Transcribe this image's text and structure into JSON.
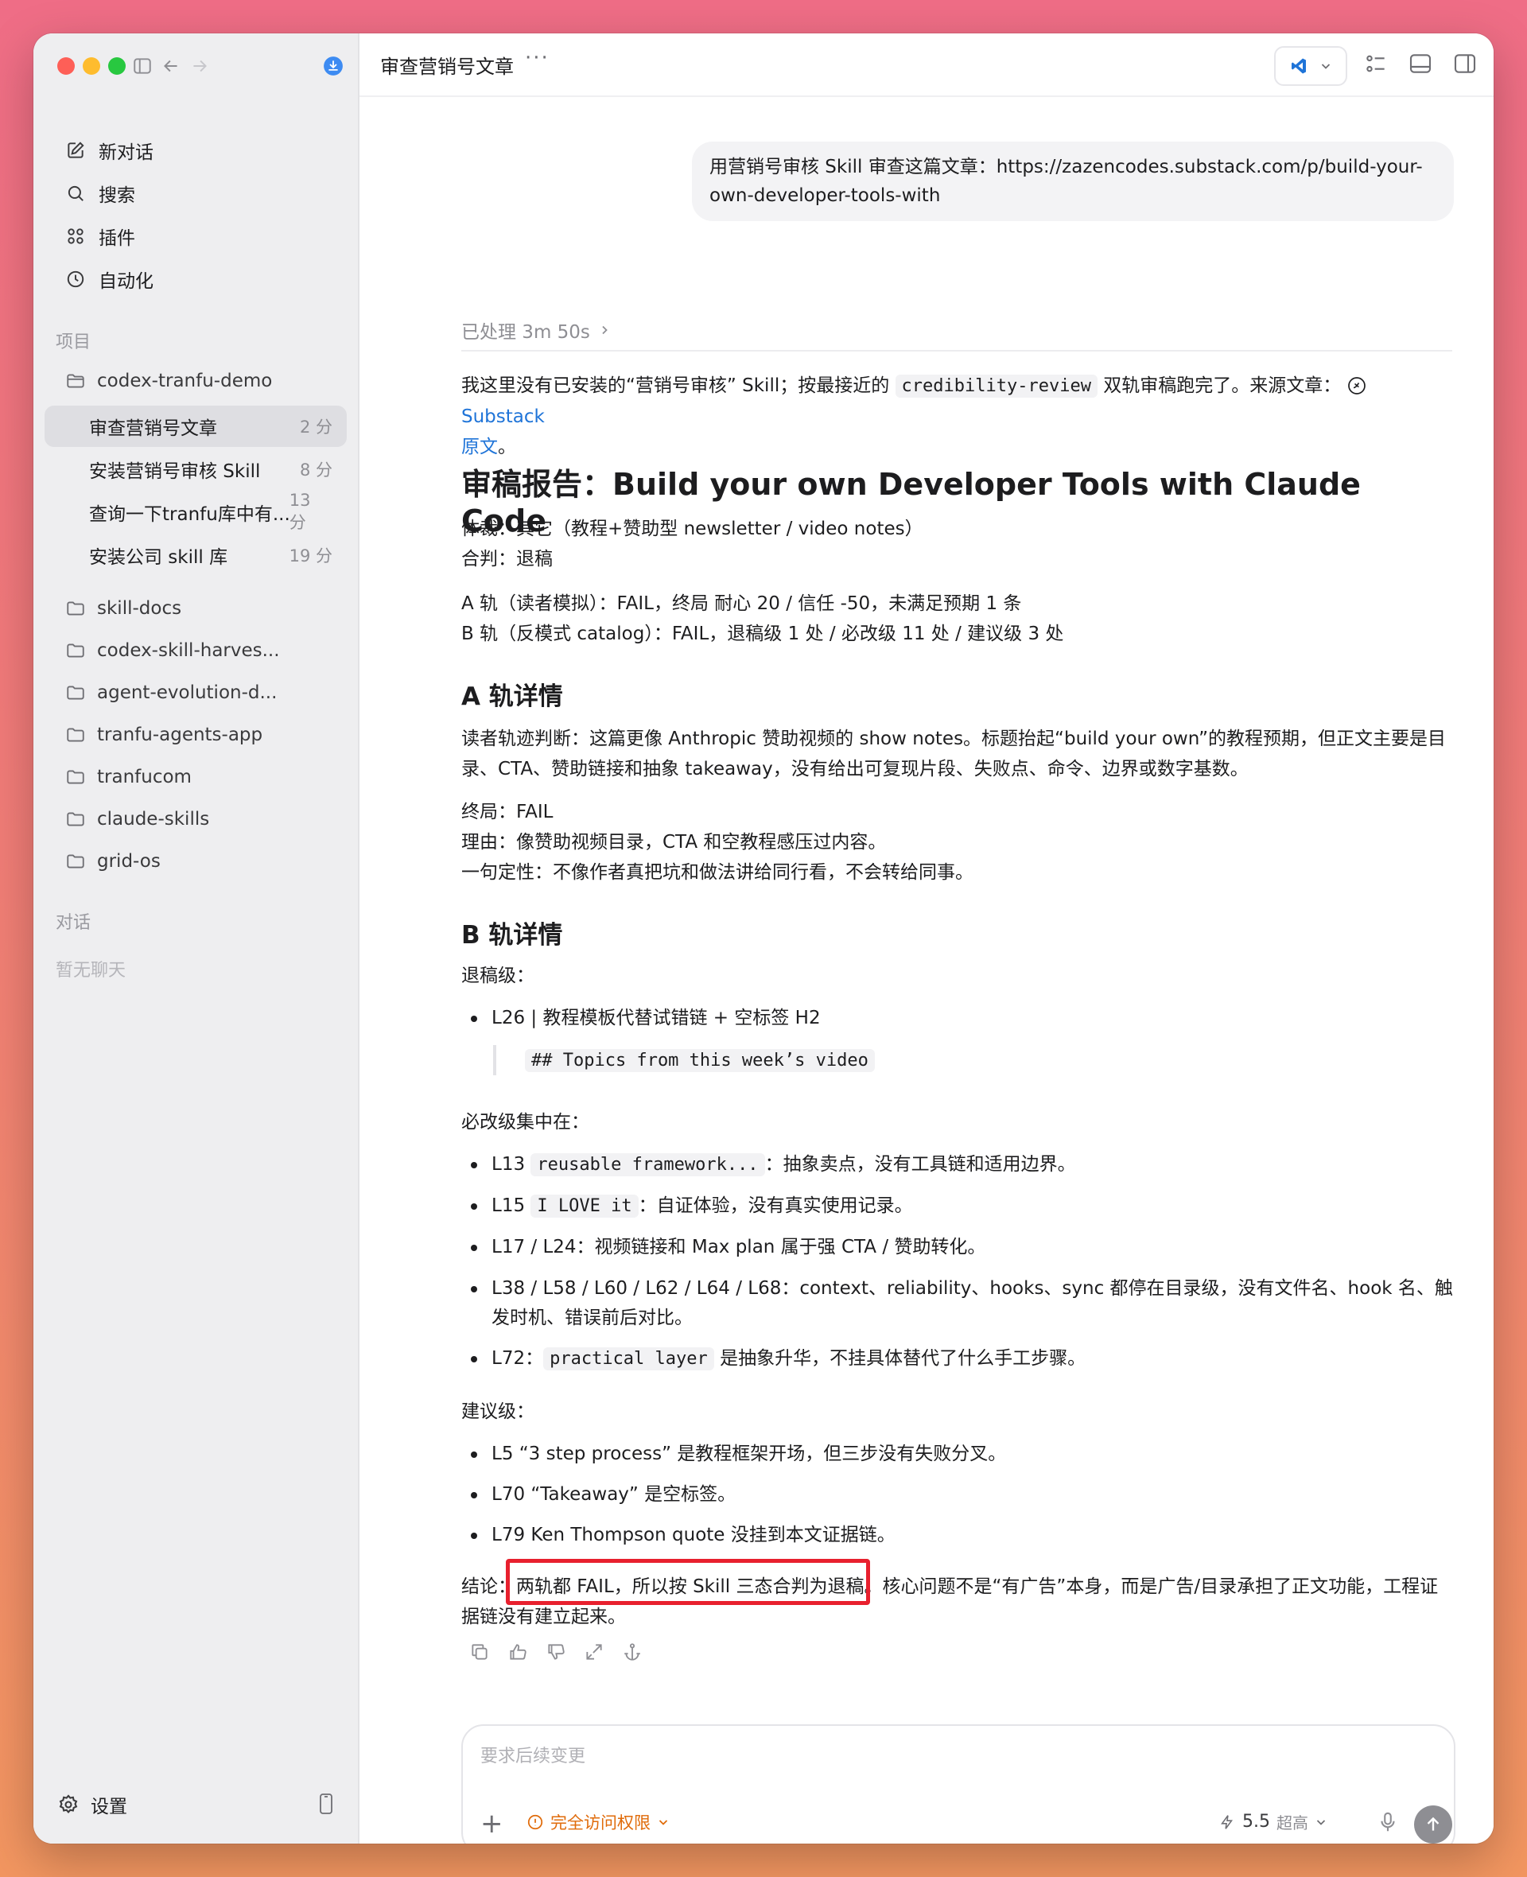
{
  "sidebar": {
    "nav": [
      {
        "label": "新对话",
        "icon": "compose-icon"
      },
      {
        "label": "搜索",
        "icon": "search-icon"
      },
      {
        "label": "插件",
        "icon": "plugins-icon"
      },
      {
        "label": "自动化",
        "icon": "clock-icon"
      }
    ],
    "projects_label": "项目",
    "active_project": "codex-tranfu-demo",
    "threads": [
      {
        "title": "审查营销号文章",
        "time": "2 分"
      },
      {
        "title": "安装营销号审核 Skill",
        "time": "8 分"
      },
      {
        "title": "查询一下tranfu库中有...",
        "time": "13 分"
      },
      {
        "title": "安装公司 skill 库",
        "time": "19 分"
      }
    ],
    "projects": [
      "skill-docs",
      "codex-skill-harves...",
      "agent-evolution-d...",
      "tranfu-agents-app",
      "tranfucom",
      "claude-skills",
      "grid-os"
    ],
    "conversations_label": "对话",
    "no_chats": "暂无聊天",
    "settings_label": "设置"
  },
  "topbar": {
    "title": "审查营销号文章",
    "more": "···"
  },
  "chat": {
    "user_message": "用营销号审核 Skill 审查这篇文章：https://zazencodes.substack.com/p/build-your-\nown-developer-tools-with",
    "processed": "已处理 3m 50s",
    "intro_a": "我这里没有已安装的“营销号审核” Skill；按最接近的",
    "intro_code": "credibility-review",
    "intro_b": "双轨审稿跑完了。来源文章：",
    "intro_link": "Substack",
    "intro_link2": "原文",
    "intro_end": "。",
    "report_title": "审稿报告：Build your own Developer Tools with Claude Code",
    "genre": "体裁：其它（教程+赞助型 newsletter / video notes）",
    "verdict": "合判：退稿",
    "track_a": "A 轨（读者模拟）：FAIL，终局 耐心 20 / 信任 -50，未满足预期 1 条",
    "track_b": "B 轨（反模式 catalog）：FAIL，退稿级 1 处 / 必改级 11 处 / 建议级 3 处",
    "a_heading": "A 轨详情",
    "a_para": "读者轨迹判断：这篇更像 Anthropic 赞助视频的 show notes。标题抬起“build your own”的教程预期，但正文主要是目录、CTA、赞助链接和抽象 takeaway，没有给出可复现片段、失败点、命令、边界或数字基数。",
    "a_end": "终局：FAIL",
    "a_reason": "理由：像赞助视频目录，CTA 和空教程感压过内容。",
    "a_oneline": "一句定性：不像作者真把坑和做法讲给同行看，不会转给同事。",
    "b_heading": "B 轨详情",
    "reject_label": "退稿级：",
    "reject_item": "L26 | 教程模板代替试错链 + 空标签 H2",
    "reject_quote": "## Topics from this week’s video",
    "must_label": "必改级集中在：",
    "must_items": [
      {
        "pre": "L13 ",
        "code": "reusable framework...",
        "post": "：抽象卖点，没有工具链和适用边界。"
      },
      {
        "pre": "L15 ",
        "code": "I LOVE it",
        "post": "：自证体验，没有真实使用记录。"
      },
      {
        "pre": "L17 / L24：视频链接和 Max plan 属于强 CTA / 赞助转化。",
        "code": "",
        "post": ""
      },
      {
        "pre": "L38 / L58 / L60 / L62 / L64 / L68：context、reliability、hooks、sync 都停在目录级，没有文件名、hook 名、触发时机、错误前后对比。",
        "code": "",
        "post": ""
      },
      {
        "pre": "L72：",
        "code": "practical layer",
        "post": "是抽象升华，不挂具体替代了什么手工步骤。"
      }
    ],
    "suggest_label": "建议级：",
    "suggest_items": [
      "L5 “3 step process” 是教程框架开场，但三步没有失败分叉。",
      "L70 “Takeaway” 是空标签。",
      "L79 Ken Thompson quote 没挂到本文证据链。"
    ],
    "conclusion_label": "结论：",
    "conclusion_highlight": "两轨都 FAIL，所以按 Skill 三态合判为退稿。",
    "conclusion_rest": "核心问题不是“有广告”本身，而是广告/目录承担了正文功能，工程证据链没有建立起来。"
  },
  "composer": {
    "placeholder": "要求后续变更",
    "access": "完全访问权限",
    "model": "5.5",
    "effort": "超高"
  },
  "colors": {
    "accent": "#1f74d8",
    "warning": "#e06b0a",
    "highlight": "#e8202e"
  }
}
